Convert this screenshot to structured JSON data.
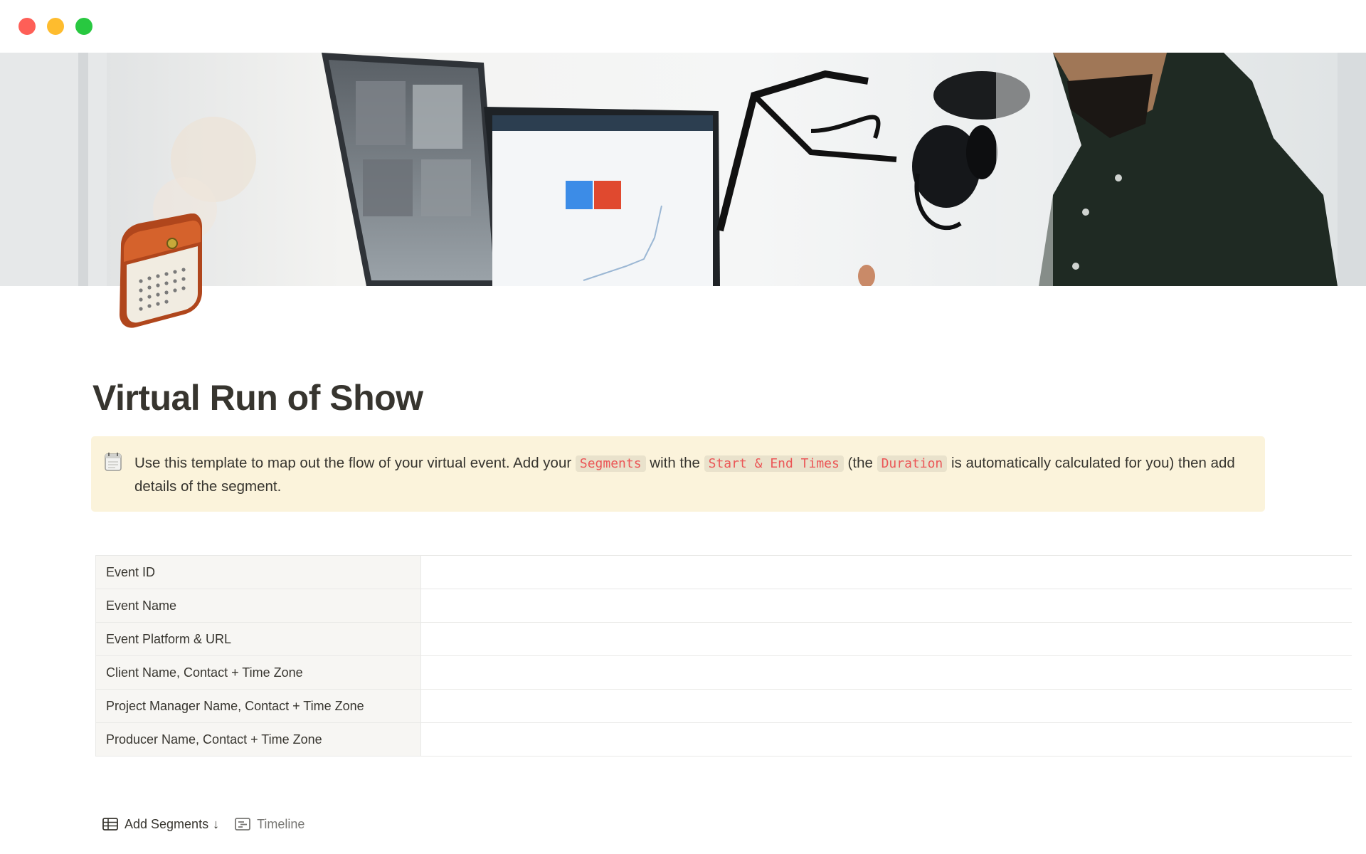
{
  "page": {
    "title": "Virtual Run of Show"
  },
  "callout": {
    "icon": "calendar-icon",
    "text_1": "Use this template to map out the flow of your virtual event. Add your ",
    "code_1": "Segments",
    "text_2": " with the ",
    "code_2": "Start & End Times",
    "text_3": " (the ",
    "code_3": "Duration",
    "text_4": " is automatically calculated for you) then add details of the segment."
  },
  "properties": [
    {
      "label": "Event ID",
      "value": ""
    },
    {
      "label": "Event Name",
      "value": ""
    },
    {
      "label": "Event Platform & URL",
      "value": ""
    },
    {
      "label": "Client Name, Contact + Time Zone",
      "value": ""
    },
    {
      "label": "Project Manager Name, Contact + Time Zone",
      "value": ""
    },
    {
      "label": "Producer Name, Contact + Time Zone",
      "value": ""
    }
  ],
  "views": [
    {
      "label": "Add Segments",
      "icon": "table-icon",
      "suffix": "↓",
      "active": true
    },
    {
      "label": "Timeline",
      "icon": "timeline-icon",
      "active": false
    }
  ],
  "colors": {
    "callout_bg": "#fbf3db",
    "code_text": "#eb5757",
    "property_bg": "#f7f6f3",
    "text": "#37352f",
    "muted_text": "#787774"
  }
}
